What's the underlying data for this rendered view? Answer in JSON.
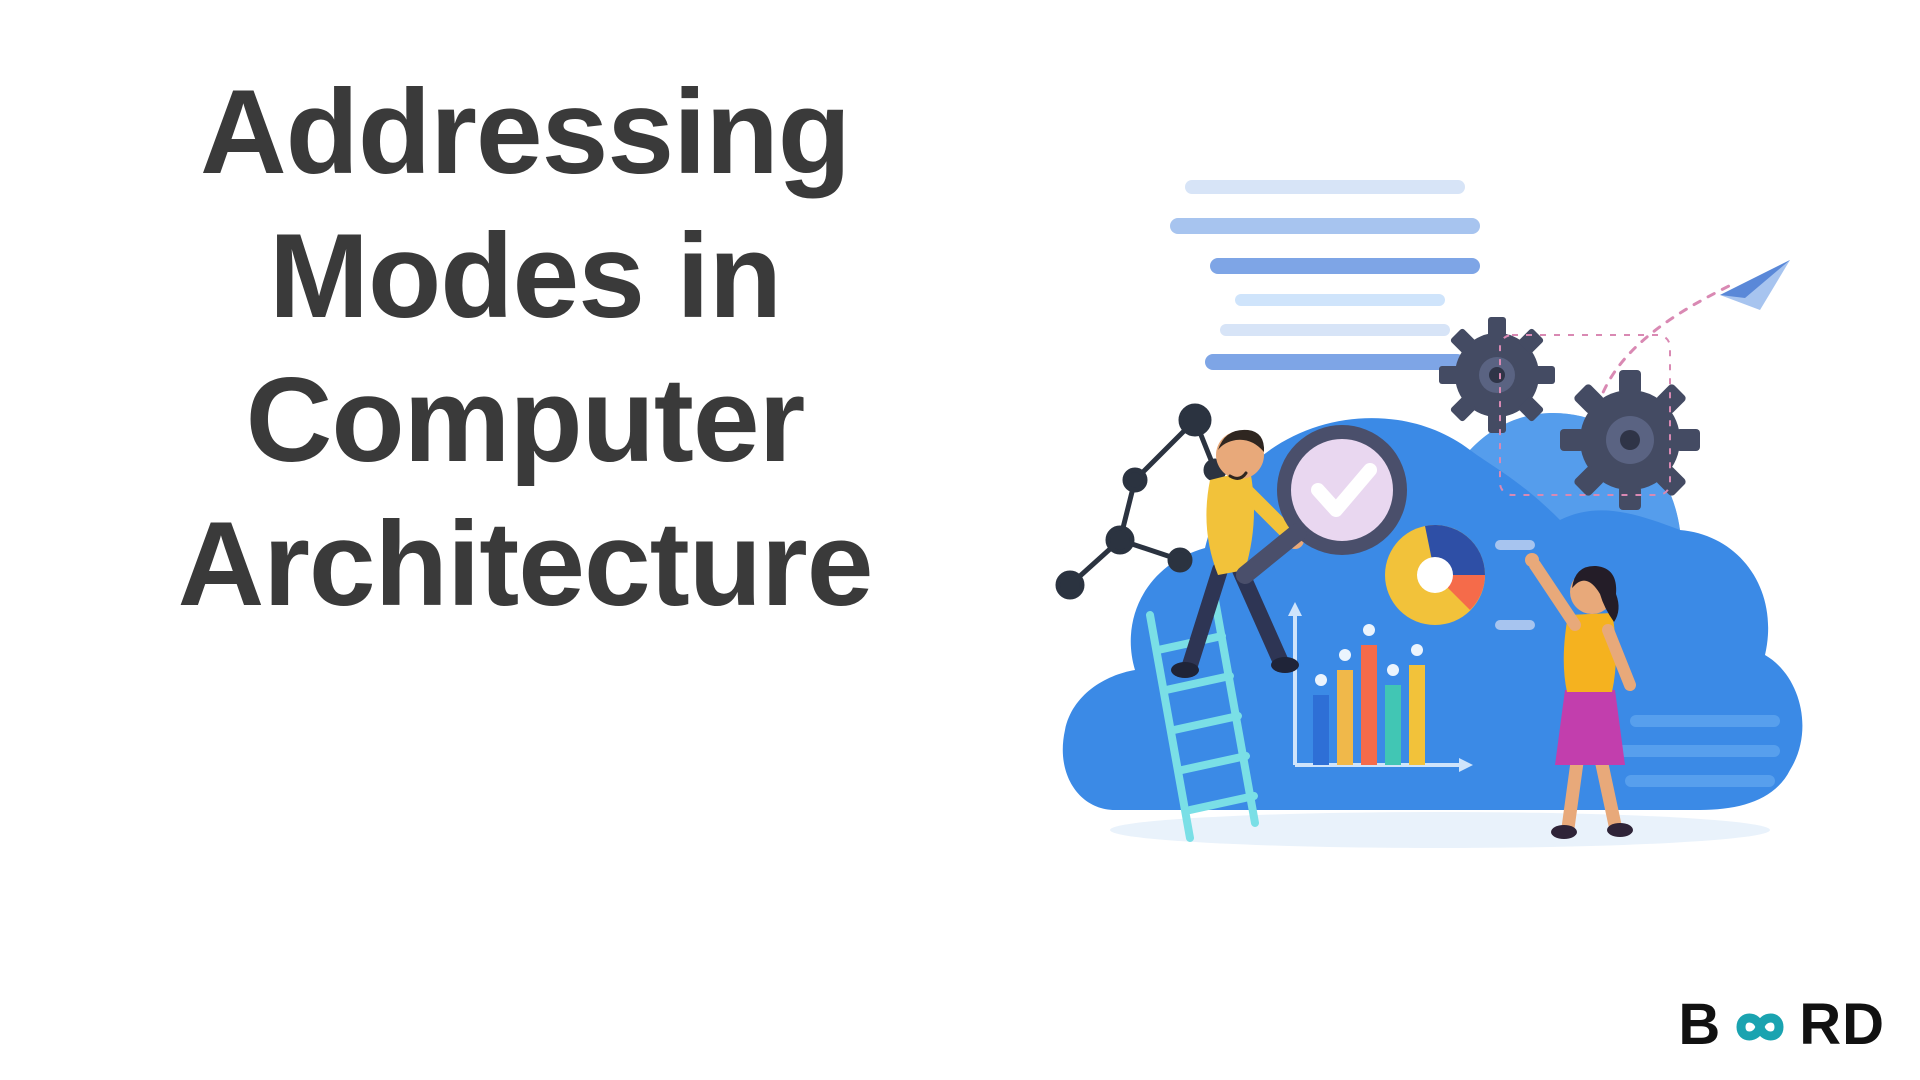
{
  "title": {
    "line1": "Addressing",
    "line2": "Modes in",
    "line3": "Computer",
    "line4": "Architecture"
  },
  "logo": {
    "left": "B",
    "right": "RD"
  },
  "colors": {
    "heading": "#3a3a3a",
    "cloud_main": "#3b8ae6",
    "cloud_dark": "#2e6fd6",
    "cloud_light": "#6fb0f2",
    "gear": "#444b63",
    "gear_hub": "#5a6382",
    "ladder": "#7adfe6",
    "node": "#2b3340",
    "person1_shirt": "#f2c23a",
    "person1_pants": "#2e3554",
    "person2_shirt": "#f5b21f",
    "person2_skirt": "#c23ead",
    "magnifier_rim": "#4a4f6b",
    "magnifier_lens": "#e9d7f0",
    "check": "#ffffff",
    "paper_plane": "#5a88d8",
    "paper_plane_fill": "#a7c4ef",
    "bar1": "#2e6fd6",
    "bar2": "#f0b84a",
    "bar3": "#f56b4a",
    "bar4": "#41c6b4",
    "bar5": "#f2c23a",
    "axis": "#cfe4fb",
    "pie1": "#f2c23a",
    "pie2": "#2e4fa6",
    "pie3": "#f56b4a",
    "pie_center": "#ffffff",
    "hline1": "#d7e4f7",
    "hline2": "#a7c4ef",
    "hline3": "#7ea5e6",
    "hline4": "#cfe4fb",
    "hline5": "#d7e4f7",
    "hline6": "#7ea5e6",
    "logo_inf": "#1aa3b0"
  }
}
